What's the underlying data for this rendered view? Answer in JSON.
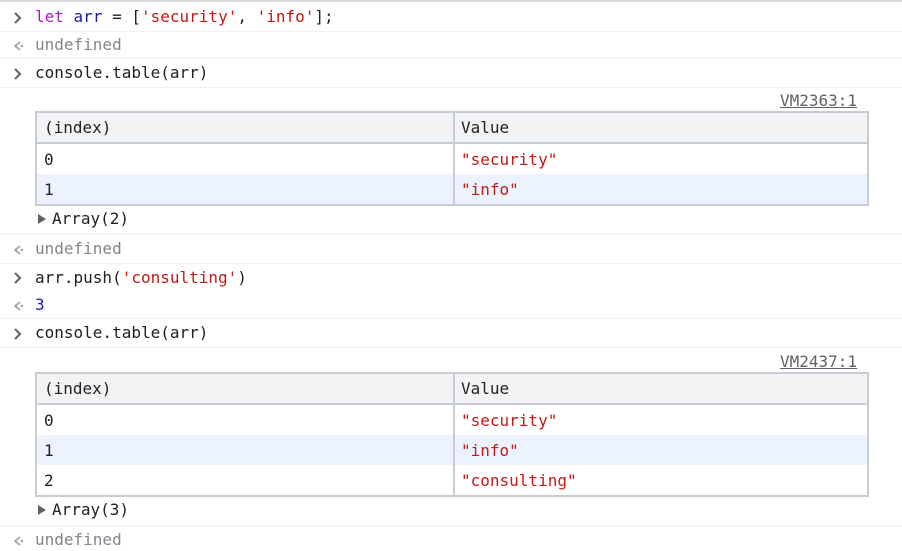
{
  "console": {
    "line1": {
      "kw": "let",
      "var": "arr",
      "eq": " = ",
      "open": "[",
      "s1": "'security'",
      "comma": ", ",
      "s2": "'info'",
      "close": "];"
    },
    "undefined": "undefined",
    "cmd_table": "console.table(arr)",
    "vm1": "VM2363:1",
    "table_headers": [
      "(index)",
      "Value"
    ],
    "table1_rows": [
      {
        "index": "0",
        "value": "\"security\""
      },
      {
        "index": "1",
        "value": "\"info\""
      }
    ],
    "array2": "Array(2)",
    "push": {
      "pre": "arr.push(",
      "arg": "'consulting'",
      "post": ")"
    },
    "push_result": "3",
    "vm2": "VM2437:1",
    "table2_rows": [
      {
        "index": "0",
        "value": "\"security\""
      },
      {
        "index": "1",
        "value": "\"info\""
      },
      {
        "index": "2",
        "value": "\"consulting\""
      }
    ],
    "array3": "Array(3)"
  },
  "colors": {
    "keyword": "#9c27b0",
    "variable": "#1a1aa6",
    "string": "#c41a16",
    "muted": "#80868b",
    "alt_row": "#edf3fe"
  },
  "icons": {
    "input_prompt": "chevron-right-icon",
    "result_prompt": "return-arrow-icon",
    "expand": "triangle-right-icon"
  }
}
